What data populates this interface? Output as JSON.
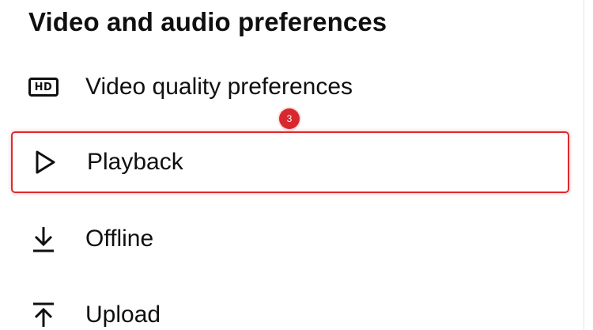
{
  "section": {
    "title": "Video and audio preferences"
  },
  "items": [
    {
      "label": "Video quality preferences",
      "icon": "hd-icon",
      "icon_text": "HD"
    },
    {
      "label": "Playback",
      "icon": "play-icon",
      "highlighted": true
    },
    {
      "label": "Offline",
      "icon": "download-icon"
    },
    {
      "label": "Upload",
      "icon": "upload-icon"
    }
  ],
  "annotation": {
    "step_badge": "3",
    "highlight_color": "#e0282e"
  }
}
